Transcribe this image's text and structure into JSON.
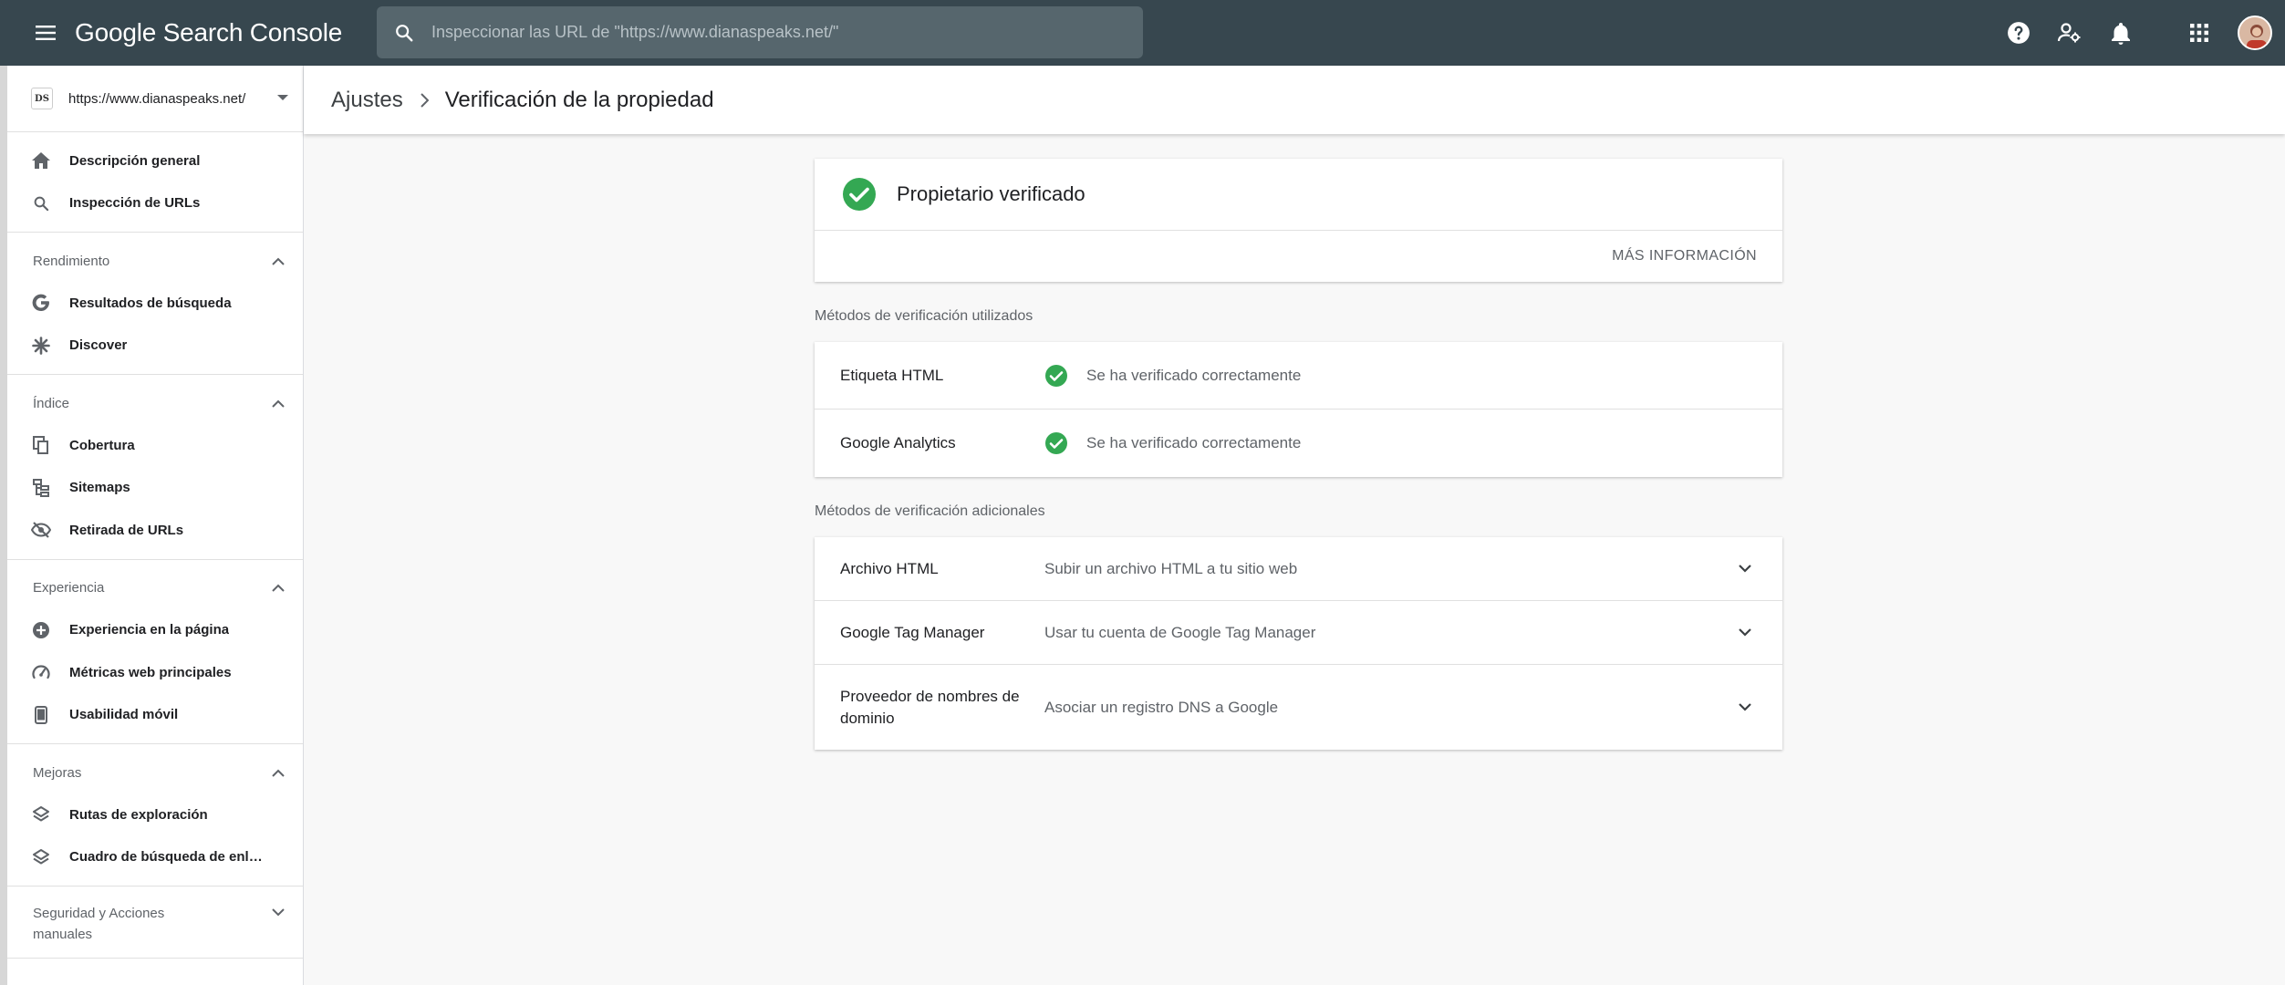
{
  "app": {
    "title_google": "Google",
    "title_product": "Search Console",
    "search_placeholder": "Inspeccionar las URL de \"https://www.dianaspeaks.net/\""
  },
  "topbar_icons": [
    "help-icon",
    "manage-users-icon",
    "notifications-icon",
    "apps-grid-icon",
    "avatar"
  ],
  "property": {
    "favicon_text": "DS",
    "url": "https://www.dianaspeaks.net/"
  },
  "sidebar": {
    "top_items": [
      {
        "label": "Descripción general",
        "icon": "home-icon"
      },
      {
        "label": "Inspección de URLs",
        "icon": "search-icon"
      }
    ],
    "groups": [
      {
        "header": "Rendimiento",
        "expanded": true,
        "items": [
          {
            "label": "Resultados de búsqueda",
            "icon": "google-g-icon"
          },
          {
            "label": "Discover",
            "icon": "asterisk-icon"
          }
        ]
      },
      {
        "header": "Índice",
        "expanded": true,
        "items": [
          {
            "label": "Cobertura",
            "icon": "copy-pages-icon"
          },
          {
            "label": "Sitemaps",
            "icon": "sitemap-icon"
          },
          {
            "label": "Retirada de URLs",
            "icon": "eye-off-icon"
          }
        ]
      },
      {
        "header": "Experiencia",
        "expanded": true,
        "items": [
          {
            "label": "Experiencia en la página",
            "icon": "add-circle-icon"
          },
          {
            "label": "Métricas web principales",
            "icon": "speed-gauge-icon"
          },
          {
            "label": "Usabilidad móvil",
            "icon": "phone-icon"
          }
        ]
      },
      {
        "header": "Mejoras",
        "expanded": true,
        "items": [
          {
            "label": "Rutas de exploración",
            "icon": "layers-icon"
          },
          {
            "label": "Cuadro de búsqueda de enlace...",
            "icon": "layers-icon"
          }
        ]
      },
      {
        "header": "Seguridad y Acciones manuales",
        "expanded": false,
        "items": []
      }
    ]
  },
  "breadcrumb": {
    "parent": "Ajustes",
    "current": "Verificación de la propiedad"
  },
  "verified_card": {
    "title": "Propietario verificado",
    "more_info": "MÁS INFORMACIÓN"
  },
  "used_methods": {
    "label": "Métodos de verificación utilizados",
    "rows": [
      {
        "name": "Etiqueta HTML",
        "status": "Se ha verificado correctamente"
      },
      {
        "name": "Google Analytics",
        "status": "Se ha verificado correctamente"
      }
    ]
  },
  "additional_methods": {
    "label": "Métodos de verificación adicionales",
    "rows": [
      {
        "name": "Archivo HTML",
        "desc": "Subir un archivo HTML a tu sitio web"
      },
      {
        "name": "Google Tag Manager",
        "desc": "Usar tu cuenta de Google Tag Manager"
      },
      {
        "name": "Proveedor de nombres de dominio",
        "desc": "Asociar un registro DNS a Google"
      }
    ]
  },
  "colors": {
    "topbar": "#37474f",
    "success_green": "#34a853",
    "text_primary": "#202124",
    "text_secondary": "#5f6368"
  }
}
